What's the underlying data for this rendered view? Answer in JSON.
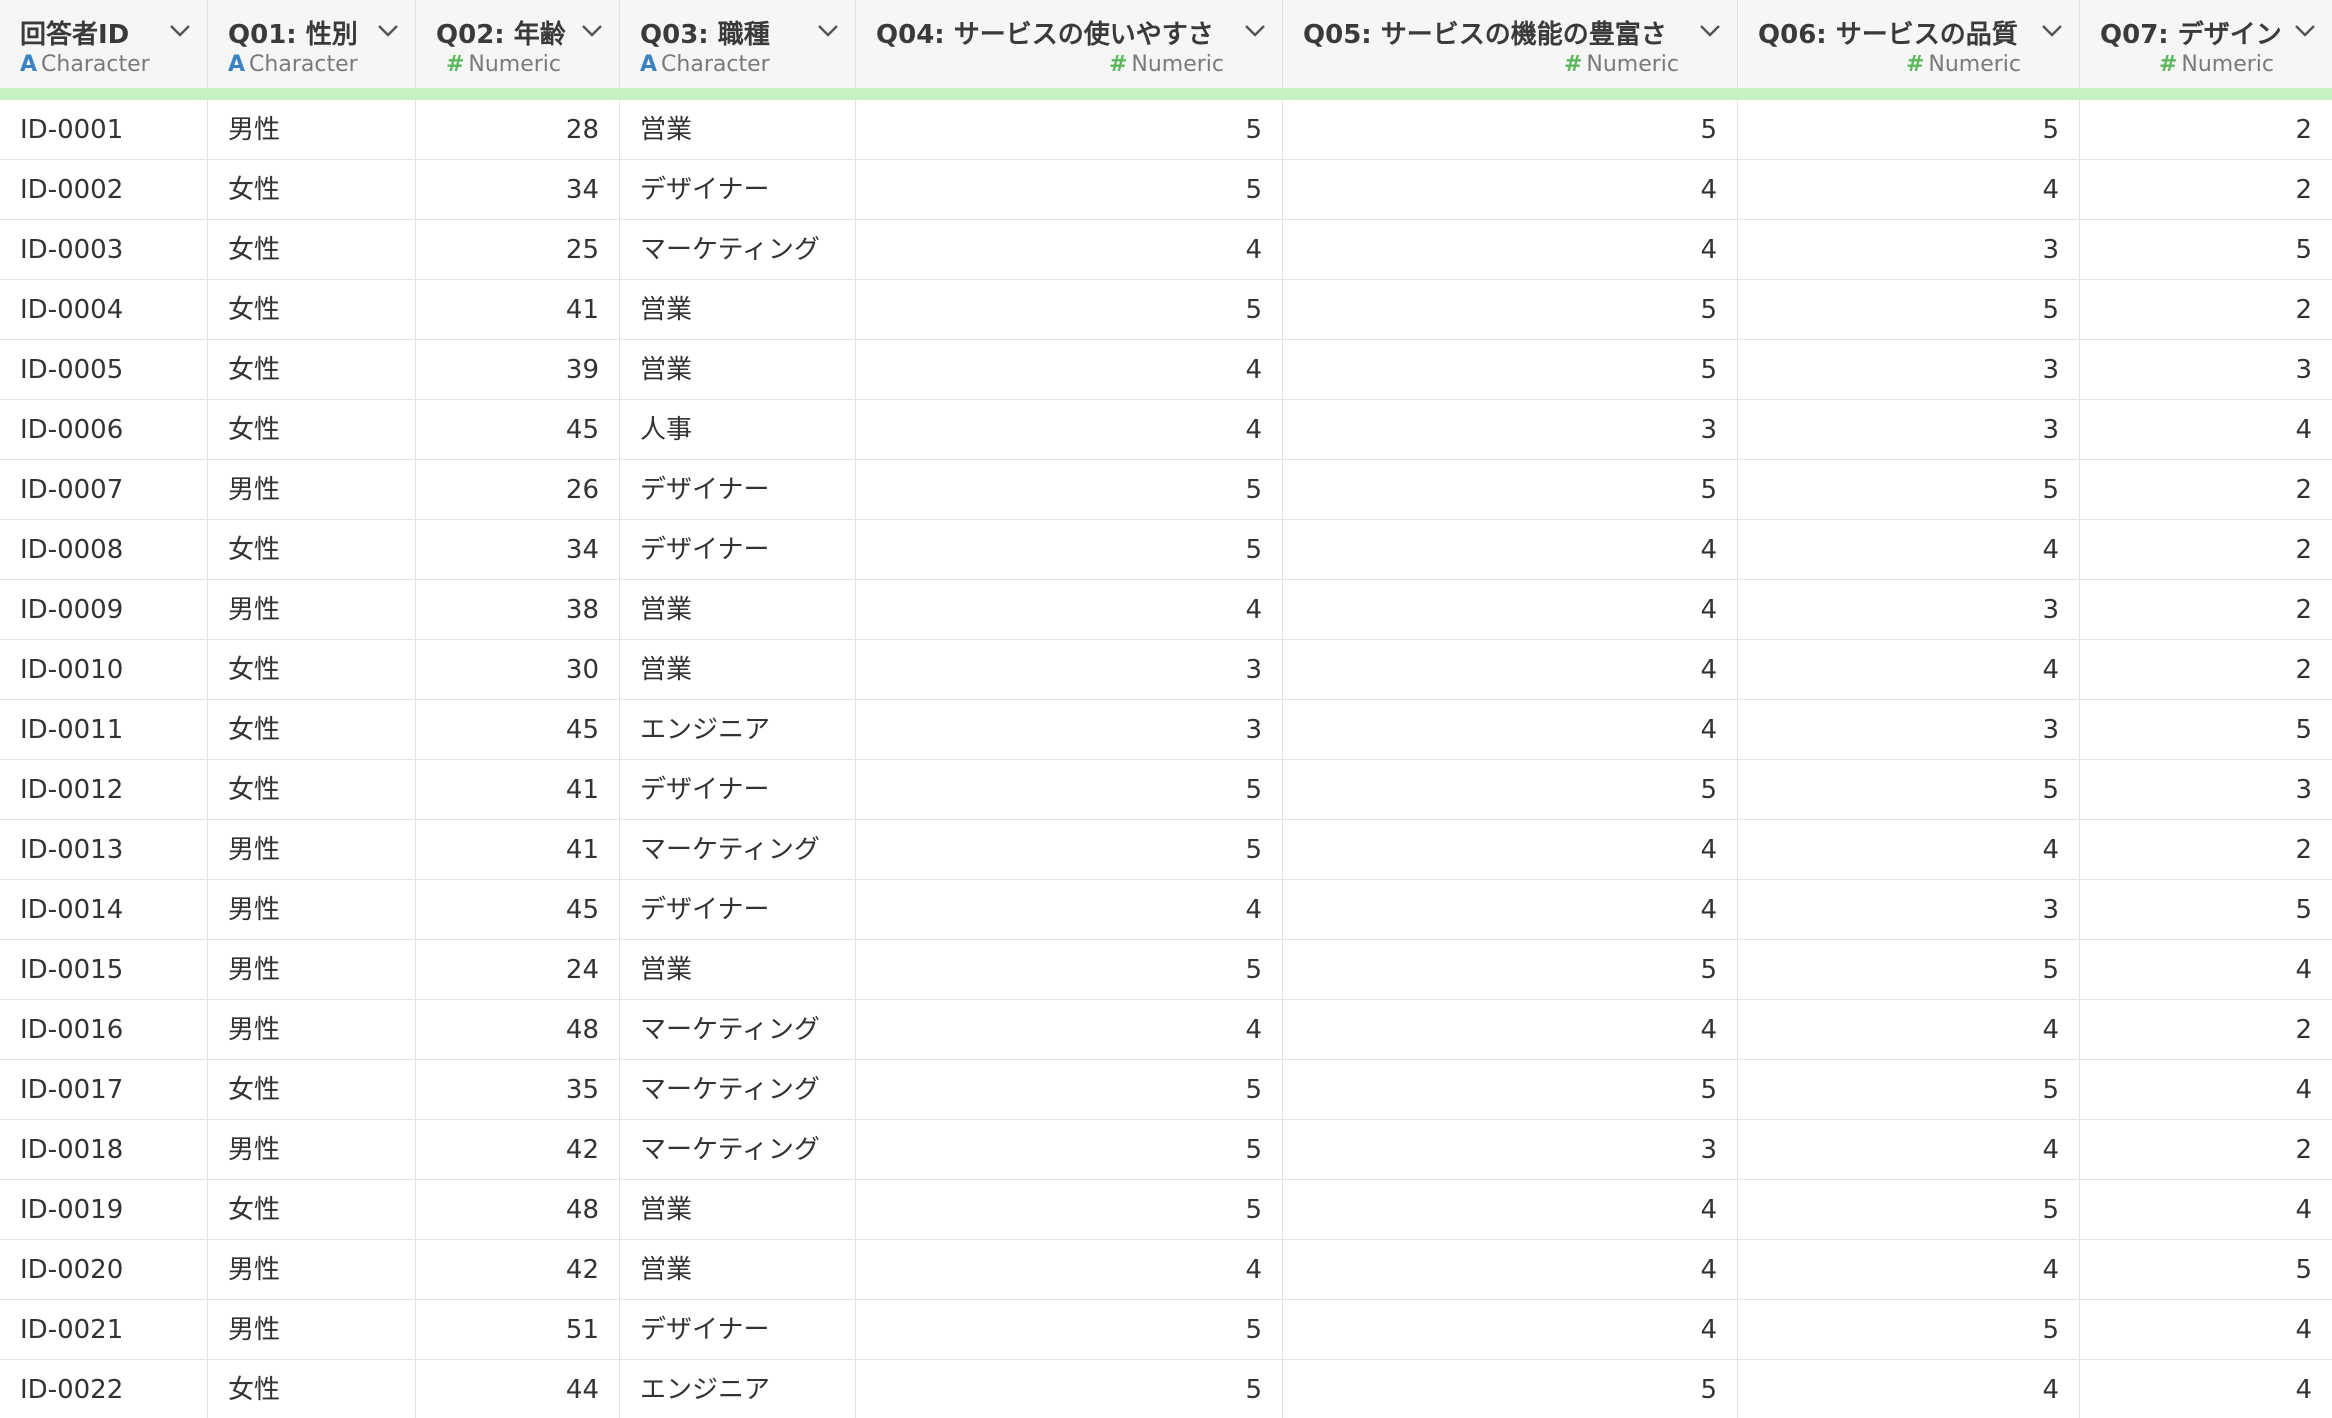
{
  "columns": [
    {
      "title": "回答者ID",
      "type": "Character",
      "type_icon": "A",
      "kind": "character"
    },
    {
      "title": "Q01: 性別",
      "type": "Character",
      "type_icon": "A",
      "kind": "character"
    },
    {
      "title": "Q02: 年齢",
      "type": "Numeric",
      "type_icon": "#",
      "kind": "numeric"
    },
    {
      "title": "Q03: 職種",
      "type": "Character",
      "type_icon": "A",
      "kind": "character"
    },
    {
      "title": "Q04: サービスの使いやすさ",
      "type": "Numeric",
      "type_icon": "#",
      "kind": "numeric"
    },
    {
      "title": "Q05: サービスの機能の豊富さ",
      "type": "Numeric",
      "type_icon": "#",
      "kind": "numeric"
    },
    {
      "title": "Q06: サービスの品質",
      "type": "Numeric",
      "type_icon": "#",
      "kind": "numeric"
    },
    {
      "title": "Q07: デザイン",
      "type": "Numeric",
      "type_icon": "#",
      "kind": "numeric"
    }
  ],
  "rows": [
    [
      "ID-0001",
      "男性",
      "28",
      "営業",
      "5",
      "5",
      "5",
      "2"
    ],
    [
      "ID-0002",
      "女性",
      "34",
      "デザイナー",
      "5",
      "4",
      "4",
      "2"
    ],
    [
      "ID-0003",
      "女性",
      "25",
      "マーケティング",
      "4",
      "4",
      "3",
      "5"
    ],
    [
      "ID-0004",
      "女性",
      "41",
      "営業",
      "5",
      "5",
      "5",
      "2"
    ],
    [
      "ID-0005",
      "女性",
      "39",
      "営業",
      "4",
      "5",
      "3",
      "3"
    ],
    [
      "ID-0006",
      "女性",
      "45",
      "人事",
      "4",
      "3",
      "3",
      "4"
    ],
    [
      "ID-0007",
      "男性",
      "26",
      "デザイナー",
      "5",
      "5",
      "5",
      "2"
    ],
    [
      "ID-0008",
      "女性",
      "34",
      "デザイナー",
      "5",
      "4",
      "4",
      "2"
    ],
    [
      "ID-0009",
      "男性",
      "38",
      "営業",
      "4",
      "4",
      "3",
      "2"
    ],
    [
      "ID-0010",
      "女性",
      "30",
      "営業",
      "3",
      "4",
      "4",
      "2"
    ],
    [
      "ID-0011",
      "女性",
      "45",
      "エンジニア",
      "3",
      "4",
      "3",
      "5"
    ],
    [
      "ID-0012",
      "女性",
      "41",
      "デザイナー",
      "5",
      "5",
      "5",
      "3"
    ],
    [
      "ID-0013",
      "男性",
      "41",
      "マーケティング",
      "5",
      "4",
      "4",
      "2"
    ],
    [
      "ID-0014",
      "男性",
      "45",
      "デザイナー",
      "4",
      "4",
      "3",
      "5"
    ],
    [
      "ID-0015",
      "男性",
      "24",
      "営業",
      "5",
      "5",
      "5",
      "4"
    ],
    [
      "ID-0016",
      "男性",
      "48",
      "マーケティング",
      "4",
      "4",
      "4",
      "2"
    ],
    [
      "ID-0017",
      "女性",
      "35",
      "マーケティング",
      "5",
      "5",
      "5",
      "4"
    ],
    [
      "ID-0018",
      "男性",
      "42",
      "マーケティング",
      "5",
      "3",
      "4",
      "2"
    ],
    [
      "ID-0019",
      "女性",
      "48",
      "営業",
      "5",
      "4",
      "5",
      "4"
    ],
    [
      "ID-0020",
      "男性",
      "42",
      "営業",
      "4",
      "4",
      "4",
      "5"
    ],
    [
      "ID-0021",
      "男性",
      "51",
      "デザイナー",
      "5",
      "4",
      "5",
      "4"
    ],
    [
      "ID-0022",
      "女性",
      "44",
      "エンジニア",
      "5",
      "5",
      "4",
      "4"
    ]
  ],
  "colors": {
    "header_bg": "#f6f6f6",
    "accent_bar": "#c6f2c2",
    "character_icon": "#3b82c4",
    "numeric_icon": "#5cb85c",
    "grid_line": "#e2e2e2"
  }
}
